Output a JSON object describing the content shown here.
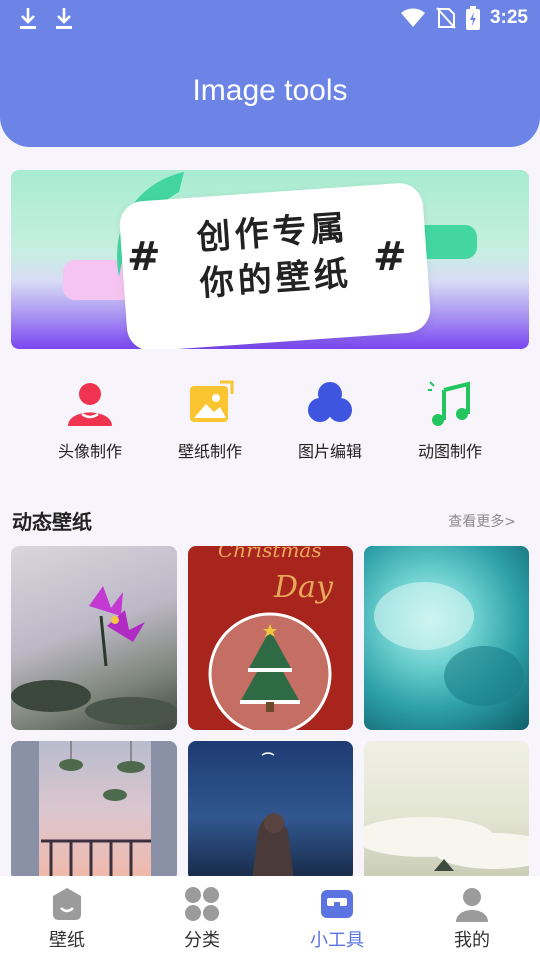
{
  "status_bar": {
    "time": "3:25"
  },
  "header": {
    "title": "Image tools"
  },
  "banner": {
    "line1": "创作专属",
    "line2": "你的壁纸",
    "hash": "#"
  },
  "tools": [
    {
      "label": "头像制作",
      "icon": "avatar-icon"
    },
    {
      "label": "壁纸制作",
      "icon": "image-frame-icon"
    },
    {
      "label": "图片编辑",
      "icon": "edit-circles-icon"
    },
    {
      "label": "动图制作",
      "icon": "music-note-icon"
    }
  ],
  "section": {
    "title": "动态壁纸",
    "more": "查看更多>"
  },
  "banner_colors": {
    "accent_green": "#43d6a2",
    "accent_purple": "#7a45f0"
  },
  "card2_text": {
    "line1": "Christmas",
    "line2": "Day"
  },
  "nav": [
    {
      "label": "壁纸",
      "icon": "wallpaper-icon",
      "active": false
    },
    {
      "label": "分类",
      "icon": "category-icon",
      "active": false
    },
    {
      "label": "小工具",
      "icon": "toolbox-icon",
      "active": true
    },
    {
      "label": "我的",
      "icon": "profile-icon",
      "active": false
    }
  ],
  "colors": {
    "primary": "#6b84e6",
    "active_nav": "#5b74e2"
  }
}
